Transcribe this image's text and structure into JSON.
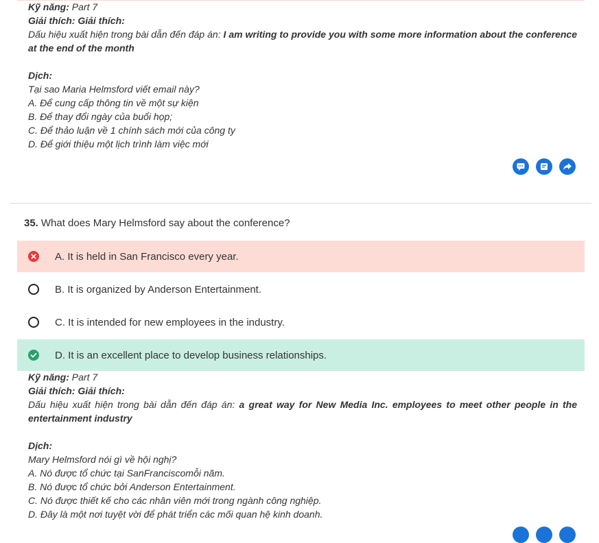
{
  "prev_explanation": {
    "skill_label": "Kỹ năng:",
    "skill_value": "Part 7",
    "explain_label": "Giải thích: Giải thích:",
    "clue_prefix": "Dấu hiệu xuất hiện trong bài dẫn đến đáp án:",
    "clue_text": "I am writing to provide you with some more information about the conference at the end of the month",
    "translate_label": "Dịch:",
    "translation_lines": [
      "Tại sao Maria Helmsford viết email này?",
      "A. Để cung cấp thông tin về một sự kiện",
      "B. Để thay đổi ngày của buổi họp;",
      "C. Để thảo luận về 1 chính sách mới của công ty",
      "D. Để giới thiệu một lịch trình làm việc mới"
    ]
  },
  "actions": {
    "comment_icon": "comment-icon",
    "note_icon": "note-icon",
    "share_icon": "share-icon",
    "accent": "#1a73d9"
  },
  "question": {
    "number": "35.",
    "text": "What does Mary Helmsford say about the conference?",
    "options": [
      {
        "label": "A. It is held in San Francisco every year.",
        "state": "wrong"
      },
      {
        "label": "B. It is organized by Anderson Entertainment.",
        "state": "none"
      },
      {
        "label": "C. It is intended for new employees in the industry.",
        "state": "none"
      },
      {
        "label": "D. It is an excellent place to develop business relationships.",
        "state": "correct"
      }
    ],
    "wrong_color": "#fddcd6",
    "correct_color": "#c9efe2"
  },
  "explanation": {
    "skill_label": "Kỹ năng:",
    "skill_value": "Part 7",
    "explain_label": "Giải thích: Giải thích:",
    "clue_prefix": "Dấu hiệu xuất hiện trong bài dẫn đến đáp án:",
    "clue_text": "a great way for New Media Inc. employees to meet other people in the entertainment industry",
    "translate_label": "Dịch:",
    "translation_lines": [
      "Mary Helmsford nói gì về hội nghị?",
      "A. Nó được tổ chức tại SanFranciscomỗi năm.",
      "B. Nó được tổ chức bởi Anderson Entertainment.",
      "C. Nó được thiết kế cho các nhân viên mới trong ngành công nghiệp.",
      "D. Đây là một nơi tuyệt vời để phát triển các mối quan hệ kinh doanh."
    ]
  }
}
